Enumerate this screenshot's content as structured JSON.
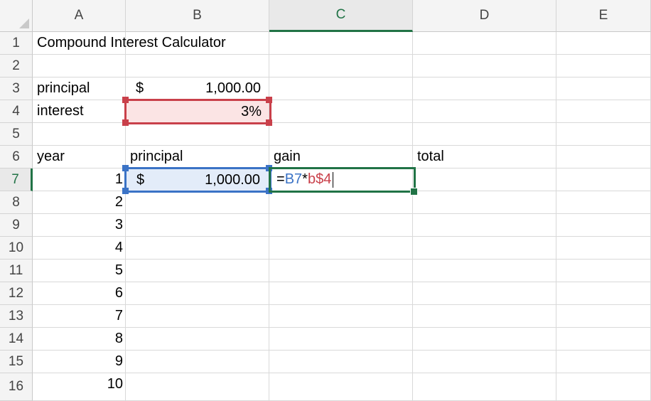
{
  "columns": [
    "A",
    "B",
    "C",
    "D",
    "E"
  ],
  "active_column": "C",
  "active_row": "7",
  "rows": [
    "1",
    "2",
    "3",
    "4",
    "5",
    "6",
    "7",
    "8",
    "9",
    "10",
    "11",
    "12",
    "13",
    "14",
    "15",
    "16"
  ],
  "cells": {
    "A1": "Compound Interest Calculator",
    "A3": "principal",
    "B3_symbol": "$",
    "B3_value": "1,000.00",
    "A4": "interest",
    "B4": "3%",
    "A6": "year",
    "B6": "principal",
    "C6": "gain",
    "D6": "total",
    "B7_symbol": "$",
    "B7_value": "1,000.00",
    "years": [
      "1",
      "2",
      "3",
      "4",
      "5",
      "6",
      "7",
      "8",
      "9",
      "10"
    ]
  },
  "formula": {
    "equals": "=",
    "ref1": "B7",
    "operator": "*",
    "ref2": "b$4"
  },
  "colors": {
    "active": "#217346",
    "ref_blue": "#3b73c6",
    "ref_red": "#c9404a"
  }
}
